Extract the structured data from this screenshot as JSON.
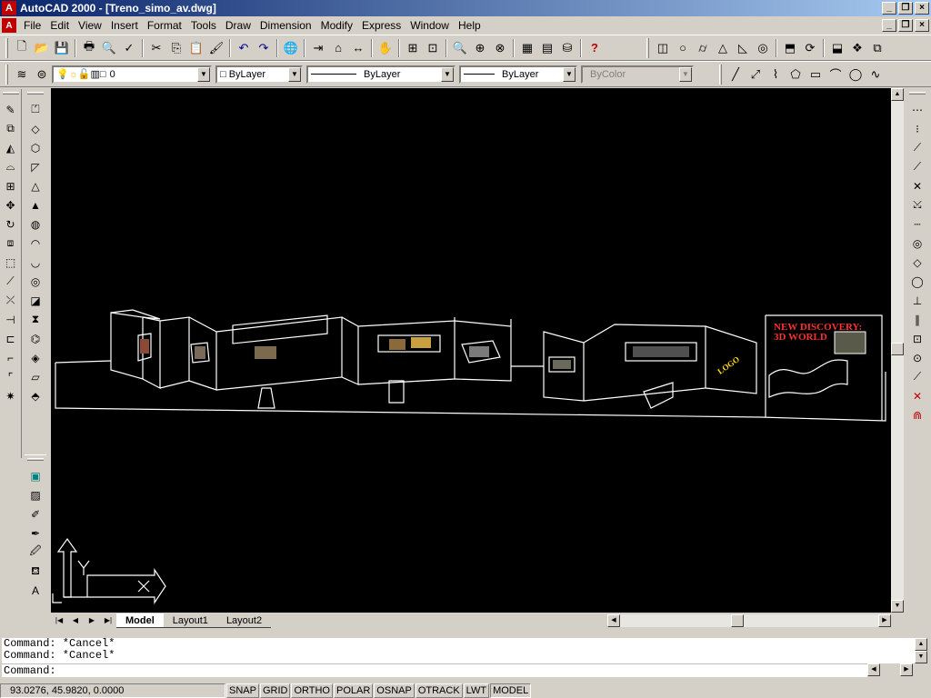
{
  "window": {
    "title": "AutoCAD 2000 - [Treno_simo_av.dwg]",
    "app_icon": "autocad-icon"
  },
  "menu": [
    "File",
    "Edit",
    "View",
    "Insert",
    "Format",
    "Tools",
    "Draw",
    "Dimension",
    "Modify",
    "Express",
    "Window",
    "Help"
  ],
  "toolbar_standard_icons": [
    "new-icon",
    "open-icon",
    "save-icon",
    "print-icon",
    "preview-icon",
    "spell-icon",
    "cut-icon",
    "copy-icon",
    "paste-icon",
    "matchprop-icon",
    "undo-icon",
    "redo-icon",
    "hyperlink-icon",
    "snap-icon",
    "block-icon",
    "dist-icon",
    "pan-icon",
    "zoom-icon",
    "zoom-window-icon",
    "aerial-icon",
    "properties-icon",
    "designcenter-icon",
    "dbconnect-icon",
    "help-icon"
  ],
  "layers": {
    "current_layer": "0",
    "color": "ByLayer",
    "linetype": "ByLayer",
    "lineweight": "ByLayer",
    "plotstyle": "ByColor"
  },
  "drawing": {
    "label_new_discovery": "NEW DISCOVERY:",
    "label_3d_world": "3D WORLD",
    "background": "#000000",
    "line_color": "#ffffff",
    "accent_text_color": "#ff3030",
    "yellow_text_color": "#ffdd00"
  },
  "tabs": {
    "model": "Model",
    "layout1": "Layout1",
    "layout2": "Layout2"
  },
  "command": {
    "history_1": "Command: *Cancel*",
    "history_2": "Command: *Cancel*",
    "prompt": "Command:"
  },
  "status": {
    "coords": "93.0276, 45.9820, 0.0000",
    "snap": "SNAP",
    "grid": "GRID",
    "ortho": "ORTHO",
    "polar": "POLAR",
    "osnap": "OSNAP",
    "otrack": "OTRACK",
    "lwt": "LWT",
    "model": "MODEL"
  }
}
